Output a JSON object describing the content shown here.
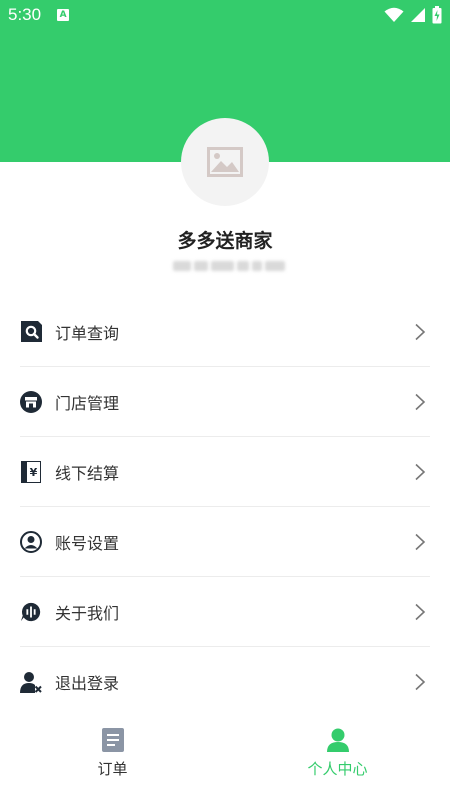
{
  "status_bar": {
    "time": "5:30",
    "notification": "A"
  },
  "profile": {
    "shop_name": "多多送商家"
  },
  "menu": {
    "items": [
      {
        "label": "订单查询",
        "icon": "order-search-icon"
      },
      {
        "label": "门店管理",
        "icon": "store-icon"
      },
      {
        "label": "线下结算",
        "icon": "settlement-icon"
      },
      {
        "label": "账号设置",
        "icon": "account-icon"
      },
      {
        "label": "关于我们",
        "icon": "about-icon"
      },
      {
        "label": "退出登录",
        "icon": "logout-icon"
      }
    ]
  },
  "bottom_nav": {
    "tabs": [
      {
        "label": "订单",
        "icon": "document-icon",
        "active": false
      },
      {
        "label": "个人中心",
        "icon": "person-icon",
        "active": true
      }
    ]
  },
  "colors": {
    "brand_green": "#34cc6c",
    "icon_dark": "#1f2a36",
    "text": "#333333"
  }
}
